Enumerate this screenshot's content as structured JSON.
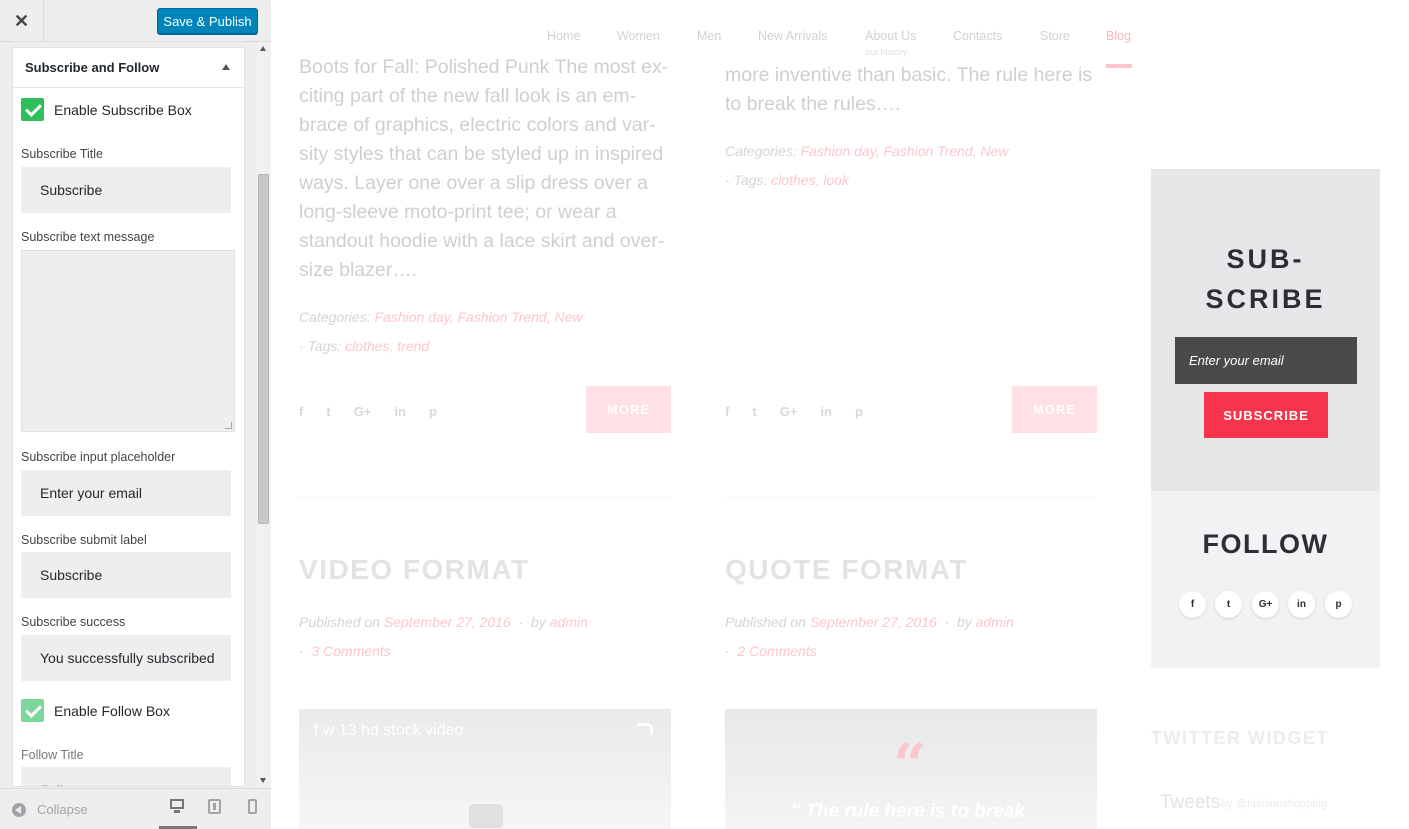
{
  "customizer": {
    "close_glyph": "✕",
    "save_label": "Save & Publish",
    "section_title": "Subscribe and Follow",
    "enable_subscribe_label": "Enable Subscribe Box",
    "subscribe_title_label": "Subscribe Title",
    "subscribe_title_value": "Subscribe",
    "subscribe_text_label": "Subscribe text message",
    "subscribe_text_value": "",
    "placeholder_label": "Subscribe input placeholder",
    "placeholder_value": "Enter your email",
    "submit_label_label": "Subscribe submit label",
    "submit_label_value": "Subscribe",
    "success_label": "Subscribe success",
    "success_value": "You successfully subscribed",
    "enable_follow_label": "Enable Follow Box",
    "follow_title_label": "Follow Title",
    "follow_title_value": "Follow",
    "collapse_label": "Collapse",
    "enable_subscribe_checked": true,
    "enable_follow_checked": true
  },
  "preview": {
    "nav": [
      "Home",
      "Women",
      "Men",
      "New Arrivals",
      "About Us",
      "Contacts",
      "Store",
      "Blog"
    ],
    "nav_sub": "our history",
    "nav_active": "Blog",
    "post1": {
      "excerpt_lines": [
        "Boots for Fall: Polished Punk The most ex-",
        "citing part of the new fall look is an em-",
        "brace of graphics, electric colors and var-",
        "sity styles that can be styled up in inspired",
        "ways. Layer one over a slip dress over a",
        "long-sleeve moto-print tee; or wear a",
        "standout hoodie with a lace skirt and over-",
        "size blazer…."
      ],
      "categories_label": "Categories:",
      "categories": "Fashion day, Fashion Trend, New",
      "tags_label": "Tags:",
      "tags": "clothes, trend",
      "more": "MORE"
    },
    "post2": {
      "excerpt_lines": [
        "more inventive than basic. The rule here is",
        "to break the rules…."
      ],
      "categories_label": "Categories:",
      "categories": "Fashion day, Fashion Trend, New",
      "tags_label": "Tags:",
      "tags": "clothes, look",
      "more": "MORE"
    },
    "share_icons": [
      "f",
      "t",
      "G+",
      "in",
      "p"
    ],
    "video_post": {
      "title": "VIDEO FORMAT",
      "published_label": "Published on",
      "date": "September 27, 2016",
      "by_label": "by",
      "author": "admin",
      "comments": "3 Comments",
      "video_title": "f w 13 hd stock video"
    },
    "quote_post": {
      "title": "QUOTE FORMAT",
      "published_label": "Published on",
      "date": "September 27, 2016",
      "by_label": "by",
      "author": "admin",
      "comments": "2 Comments",
      "quote_mark": "“",
      "quote_text": "\" The rule here is to break"
    },
    "subscribe_widget": {
      "title_line1": "SUB-",
      "title_line2": "SCRIBE",
      "email_placeholder": "Enter your email",
      "button": "SUBSCRIBE"
    },
    "follow_widget": {
      "title": "FOLLOW",
      "icons": [
        "f",
        "t",
        "G+",
        "in",
        "p"
      ]
    },
    "twitter_widget": {
      "title": "TWITTER WIDGET",
      "tweets": "Tweets",
      "by": "by @fashionshopping"
    }
  },
  "colors": {
    "publish_blue": "#0085ba",
    "check_green": "#2ebf5a",
    "subscribe_red": "#f6344c",
    "accent_pink": "#fbc7cd"
  }
}
